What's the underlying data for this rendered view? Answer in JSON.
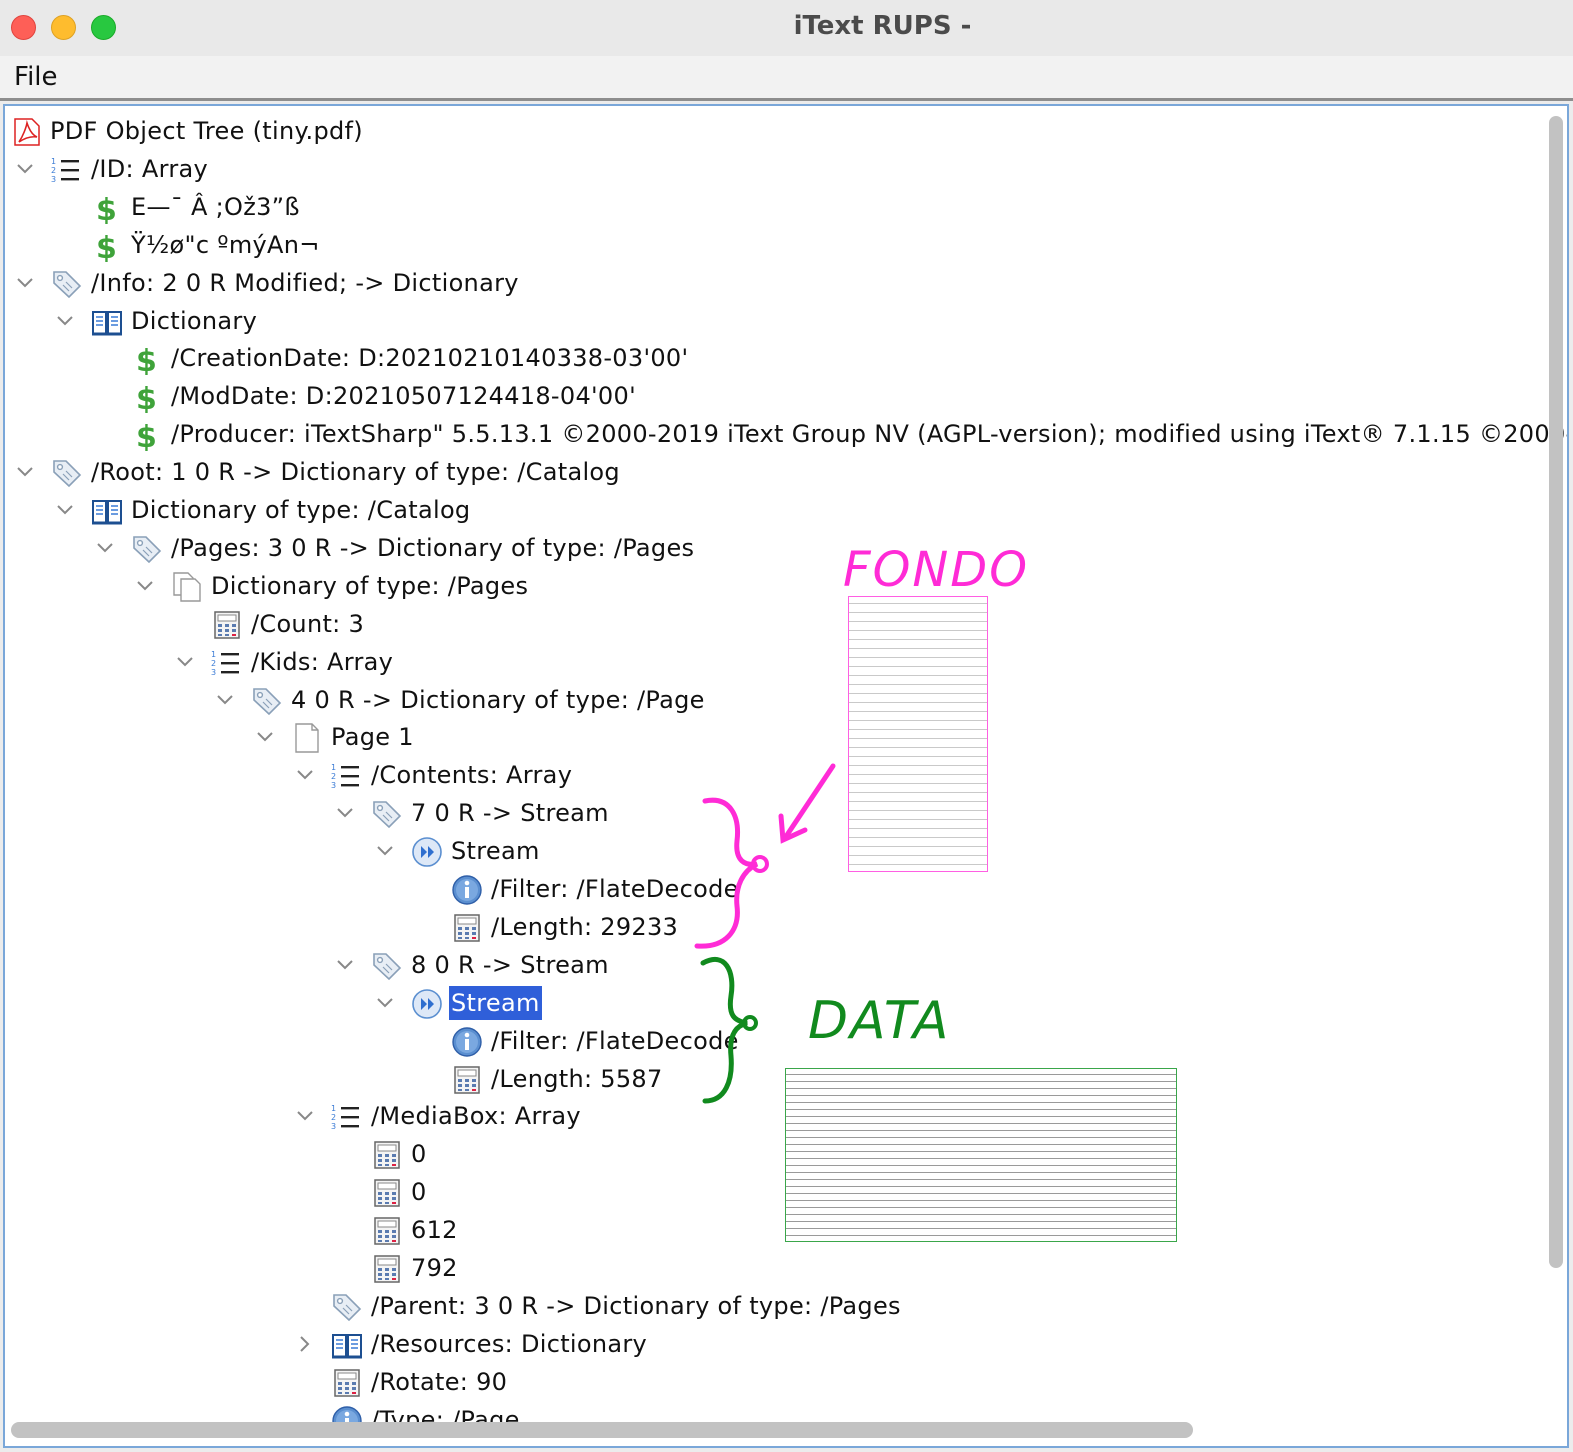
{
  "window": {
    "title": "iText RUPS -"
  },
  "menu": {
    "file": "File"
  },
  "tree": [
    {
      "depth": 0,
      "chev": "none",
      "icon": "pdf-icon",
      "label": "PDF Object Tree (tiny.pdf)"
    },
    {
      "depth": 0,
      "chev": "down",
      "icon": "array-icon",
      "label": "/ID: Array"
    },
    {
      "depth": 1,
      "chev": "none",
      "icon": "string-icon",
      "label": "E—¯ Â ;Ož3”ß"
    },
    {
      "depth": 1,
      "chev": "none",
      "icon": "string-icon",
      "label": " Ÿ½ø\"c  ºmýAn¬"
    },
    {
      "depth": 0,
      "chev": "down",
      "icon": "indirect-ref-icon",
      "label": "/Info: 2 0 R Modified; -> Dictionary"
    },
    {
      "depth": 1,
      "chev": "down",
      "icon": "dictionary-icon",
      "label": "Dictionary"
    },
    {
      "depth": 2,
      "chev": "none",
      "icon": "string-icon",
      "label": "/CreationDate: D:20210210140338-03'00'"
    },
    {
      "depth": 2,
      "chev": "none",
      "icon": "string-icon",
      "label": "/ModDate: D:20210507124418-04'00'"
    },
    {
      "depth": 2,
      "chev": "none",
      "icon": "string-icon",
      "label": "/Producer: iTextSharp\" 5.5.13.1 ©2000-2019 iText Group NV (AGPL-version); modified using iText® 7.1.15 ©2000-"
    },
    {
      "depth": 0,
      "chev": "down",
      "icon": "indirect-ref-icon",
      "label": "/Root: 1 0 R -> Dictionary of type: /Catalog"
    },
    {
      "depth": 1,
      "chev": "down",
      "icon": "dictionary-icon",
      "label": "Dictionary of type: /Catalog"
    },
    {
      "depth": 2,
      "chev": "down",
      "icon": "indirect-ref-icon",
      "label": "/Pages: 3 0 R -> Dictionary of type: /Pages"
    },
    {
      "depth": 3,
      "chev": "down",
      "icon": "pages-icon",
      "label": "Dictionary of type: /Pages"
    },
    {
      "depth": 4,
      "chev": "none",
      "icon": "number-icon",
      "label": "/Count: 3"
    },
    {
      "depth": 4,
      "chev": "down",
      "icon": "array-icon",
      "label": "/Kids: Array"
    },
    {
      "depth": 5,
      "chev": "down",
      "icon": "indirect-ref-icon",
      "label": "4 0 R -> Dictionary of type: /Page"
    },
    {
      "depth": 6,
      "chev": "down",
      "icon": "page-icon",
      "label": "Page 1"
    },
    {
      "depth": 7,
      "chev": "down",
      "icon": "array-icon",
      "label": "/Contents: Array"
    },
    {
      "depth": 8,
      "chev": "down",
      "icon": "indirect-ref-icon",
      "label": "7 0 R -> Stream"
    },
    {
      "depth": 9,
      "chev": "down",
      "icon": "stream-icon",
      "label": "Stream"
    },
    {
      "depth": 10,
      "chev": "none",
      "icon": "name-icon",
      "label": "/Filter: /FlateDecode"
    },
    {
      "depth": 10,
      "chev": "none",
      "icon": "number-icon",
      "label": "/Length: 29233"
    },
    {
      "depth": 8,
      "chev": "down",
      "icon": "indirect-ref-icon",
      "label": "8 0 R -> Stream"
    },
    {
      "depth": 9,
      "chev": "down",
      "icon": "stream-icon",
      "label": "Stream",
      "selected": true
    },
    {
      "depth": 10,
      "chev": "none",
      "icon": "name-icon",
      "label": "/Filter: /FlateDecode"
    },
    {
      "depth": 10,
      "chev": "none",
      "icon": "number-icon",
      "label": "/Length: 5587"
    },
    {
      "depth": 7,
      "chev": "down",
      "icon": "array-icon",
      "label": "/MediaBox: Array"
    },
    {
      "depth": 8,
      "chev": "none",
      "icon": "number-icon",
      "label": "0"
    },
    {
      "depth": 8,
      "chev": "none",
      "icon": "number-icon",
      "label": "0"
    },
    {
      "depth": 8,
      "chev": "none",
      "icon": "number-icon",
      "label": "612"
    },
    {
      "depth": 8,
      "chev": "none",
      "icon": "number-icon",
      "label": "792"
    },
    {
      "depth": 7,
      "chev": "none",
      "icon": "indirect-ref-icon",
      "label": "/Parent: 3 0 R -> Dictionary of type: /Pages"
    },
    {
      "depth": 7,
      "chev": "right",
      "icon": "dictionary-icon",
      "label": "/Resources: Dictionary"
    },
    {
      "depth": 7,
      "chev": "none",
      "icon": "number-icon",
      "label": "/Rotate: 90"
    },
    {
      "depth": 7,
      "chev": "none",
      "icon": "name-icon",
      "label": "/Type: /Page"
    }
  ],
  "annotations": {
    "fondo": {
      "text": "FONDO",
      "color": "#ff2bd6"
    },
    "data": {
      "text": "DATA",
      "color": "#118a1e"
    }
  },
  "colors": {
    "selection": "#2f5fd9",
    "panel_border": "#7aa7d9"
  }
}
